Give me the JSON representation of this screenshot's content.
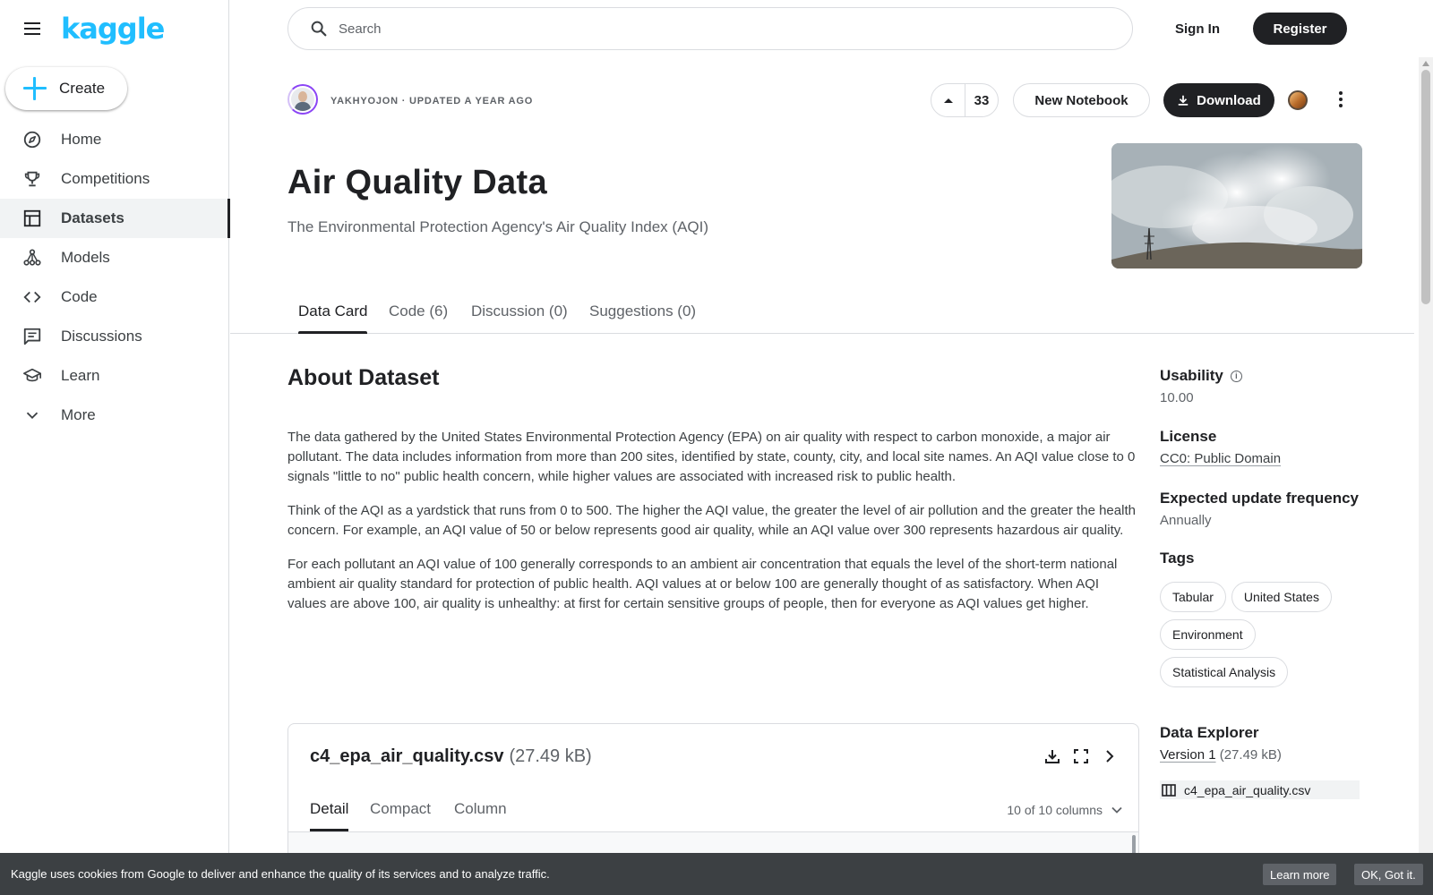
{
  "sidebar": {
    "logo": "kaggle",
    "create_label": "Create",
    "items": [
      {
        "label": "Home",
        "icon": "compass-icon"
      },
      {
        "label": "Competitions",
        "icon": "trophy-icon"
      },
      {
        "label": "Datasets",
        "icon": "table-icon",
        "active": true
      },
      {
        "label": "Models",
        "icon": "models-icon"
      },
      {
        "label": "Code",
        "icon": "code-icon"
      },
      {
        "label": "Discussions",
        "icon": "discussion-icon"
      },
      {
        "label": "Learn",
        "icon": "school-icon"
      },
      {
        "label": "More",
        "icon": "chevron-down-icon"
      }
    ]
  },
  "header": {
    "search_placeholder": "Search",
    "sign_in": "Sign In",
    "register": "Register"
  },
  "dataset": {
    "author_line": "YAKHYOJON · UPDATED A YEAR AGO",
    "upvotes": "33",
    "new_notebook": "New Notebook",
    "download": "Download",
    "title": "Air Quality Data",
    "subtitle": "The Environmental Protection Agency's Air Quality Index (AQI)"
  },
  "tabs": [
    {
      "label": "Data Card",
      "active": true
    },
    {
      "label": "Code (6)"
    },
    {
      "label": "Discussion (0)"
    },
    {
      "label": "Suggestions (0)"
    }
  ],
  "about": {
    "heading": "About Dataset",
    "paragraphs": [
      "The data gathered by the United States Environmental Protection Agency (EPA) on air quality with respect to carbon monoxide, a major air pollutant. The data includes information from more than 200 sites, identified by state, county, city, and local site names. An AQI value close to 0 signals \"little to no\" public health concern, while higher values are associated with increased risk to public health.",
      "Think of the AQI as a yardstick that runs from 0 to 500. The higher the AQI value, the greater the level of air pollution and the greater the health concern. For example, an AQI value of 50 or below represents good air quality, while an AQI value over 300 represents hazardous air quality.",
      "For each pollutant an AQI value of 100 generally corresponds to an ambient air concentration that equals the level of the short-term national ambient air quality standard for protection of public health. AQI values at or below 100 are generally thought of as satisfactory. When AQI values are above 100, air quality is unhealthy: at first for certain sensitive groups of people, then for everyone as AQI values get higher."
    ]
  },
  "meta": {
    "usability_label": "Usability",
    "usability_value": "10.00",
    "license_label": "License",
    "license_value": "CC0: Public Domain",
    "frequency_label": "Expected update frequency",
    "frequency_value": "Annually",
    "tags_label": "Tags",
    "tags": [
      "Tabular",
      "United States",
      "Environment",
      "Statistical Analysis"
    ],
    "explorer_label": "Data Explorer",
    "version_label": "Version 1",
    "version_size": "(27.49 kB)",
    "file_name": "c4_epa_air_quality.csv"
  },
  "file_card": {
    "name": "c4_epa_air_quality.csv",
    "size": "(27.49 kB)",
    "tabs": [
      "Detail",
      "Compact",
      "Column"
    ],
    "columns": "10 of 10 columns"
  },
  "cookie": {
    "text": "Kaggle uses cookies from Google to deliver and enhance the quality of its services and to analyze traffic.",
    "learn_more": "Learn more",
    "ok": "OK, Got it."
  },
  "colors": {
    "brand": "#20beff",
    "dark": "#202124",
    "border": "#dadce0"
  }
}
